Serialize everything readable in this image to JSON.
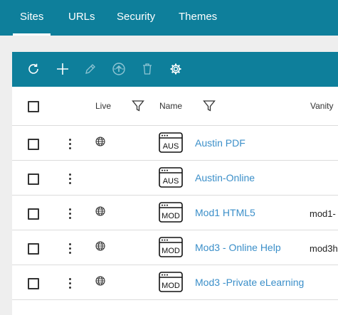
{
  "nav": {
    "tabs": [
      {
        "label": "Sites",
        "active": true
      },
      {
        "label": "URLs",
        "active": false
      },
      {
        "label": "Security",
        "active": false
      },
      {
        "label": "Themes",
        "active": false
      }
    ]
  },
  "toolbar": {
    "icons": [
      "refresh-icon",
      "plus-icon",
      "pencil-icon",
      "publish-icon",
      "trash-icon",
      "gear-icon"
    ]
  },
  "table": {
    "headers": {
      "live": "Live",
      "name": "Name",
      "vanity": "Vanity"
    },
    "rows": [
      {
        "live": true,
        "icon_label": "AUS",
        "name": "Austin PDF",
        "vanity": ""
      },
      {
        "live": false,
        "icon_label": "AUS",
        "name": "Austin-Online",
        "vanity": ""
      },
      {
        "live": true,
        "icon_label": "MOD",
        "name": "Mod1 HTML5",
        "vanity": "mod1-"
      },
      {
        "live": true,
        "icon_label": "MOD",
        "name": "Mod3 - Online Help",
        "vanity": "mod3h"
      },
      {
        "live": true,
        "icon_label": "MOD",
        "name": "Mod3 -Private eLearning",
        "vanity": ""
      }
    ]
  },
  "colors": {
    "brand": "#0e7f9b",
    "link": "#3b8fc9"
  }
}
